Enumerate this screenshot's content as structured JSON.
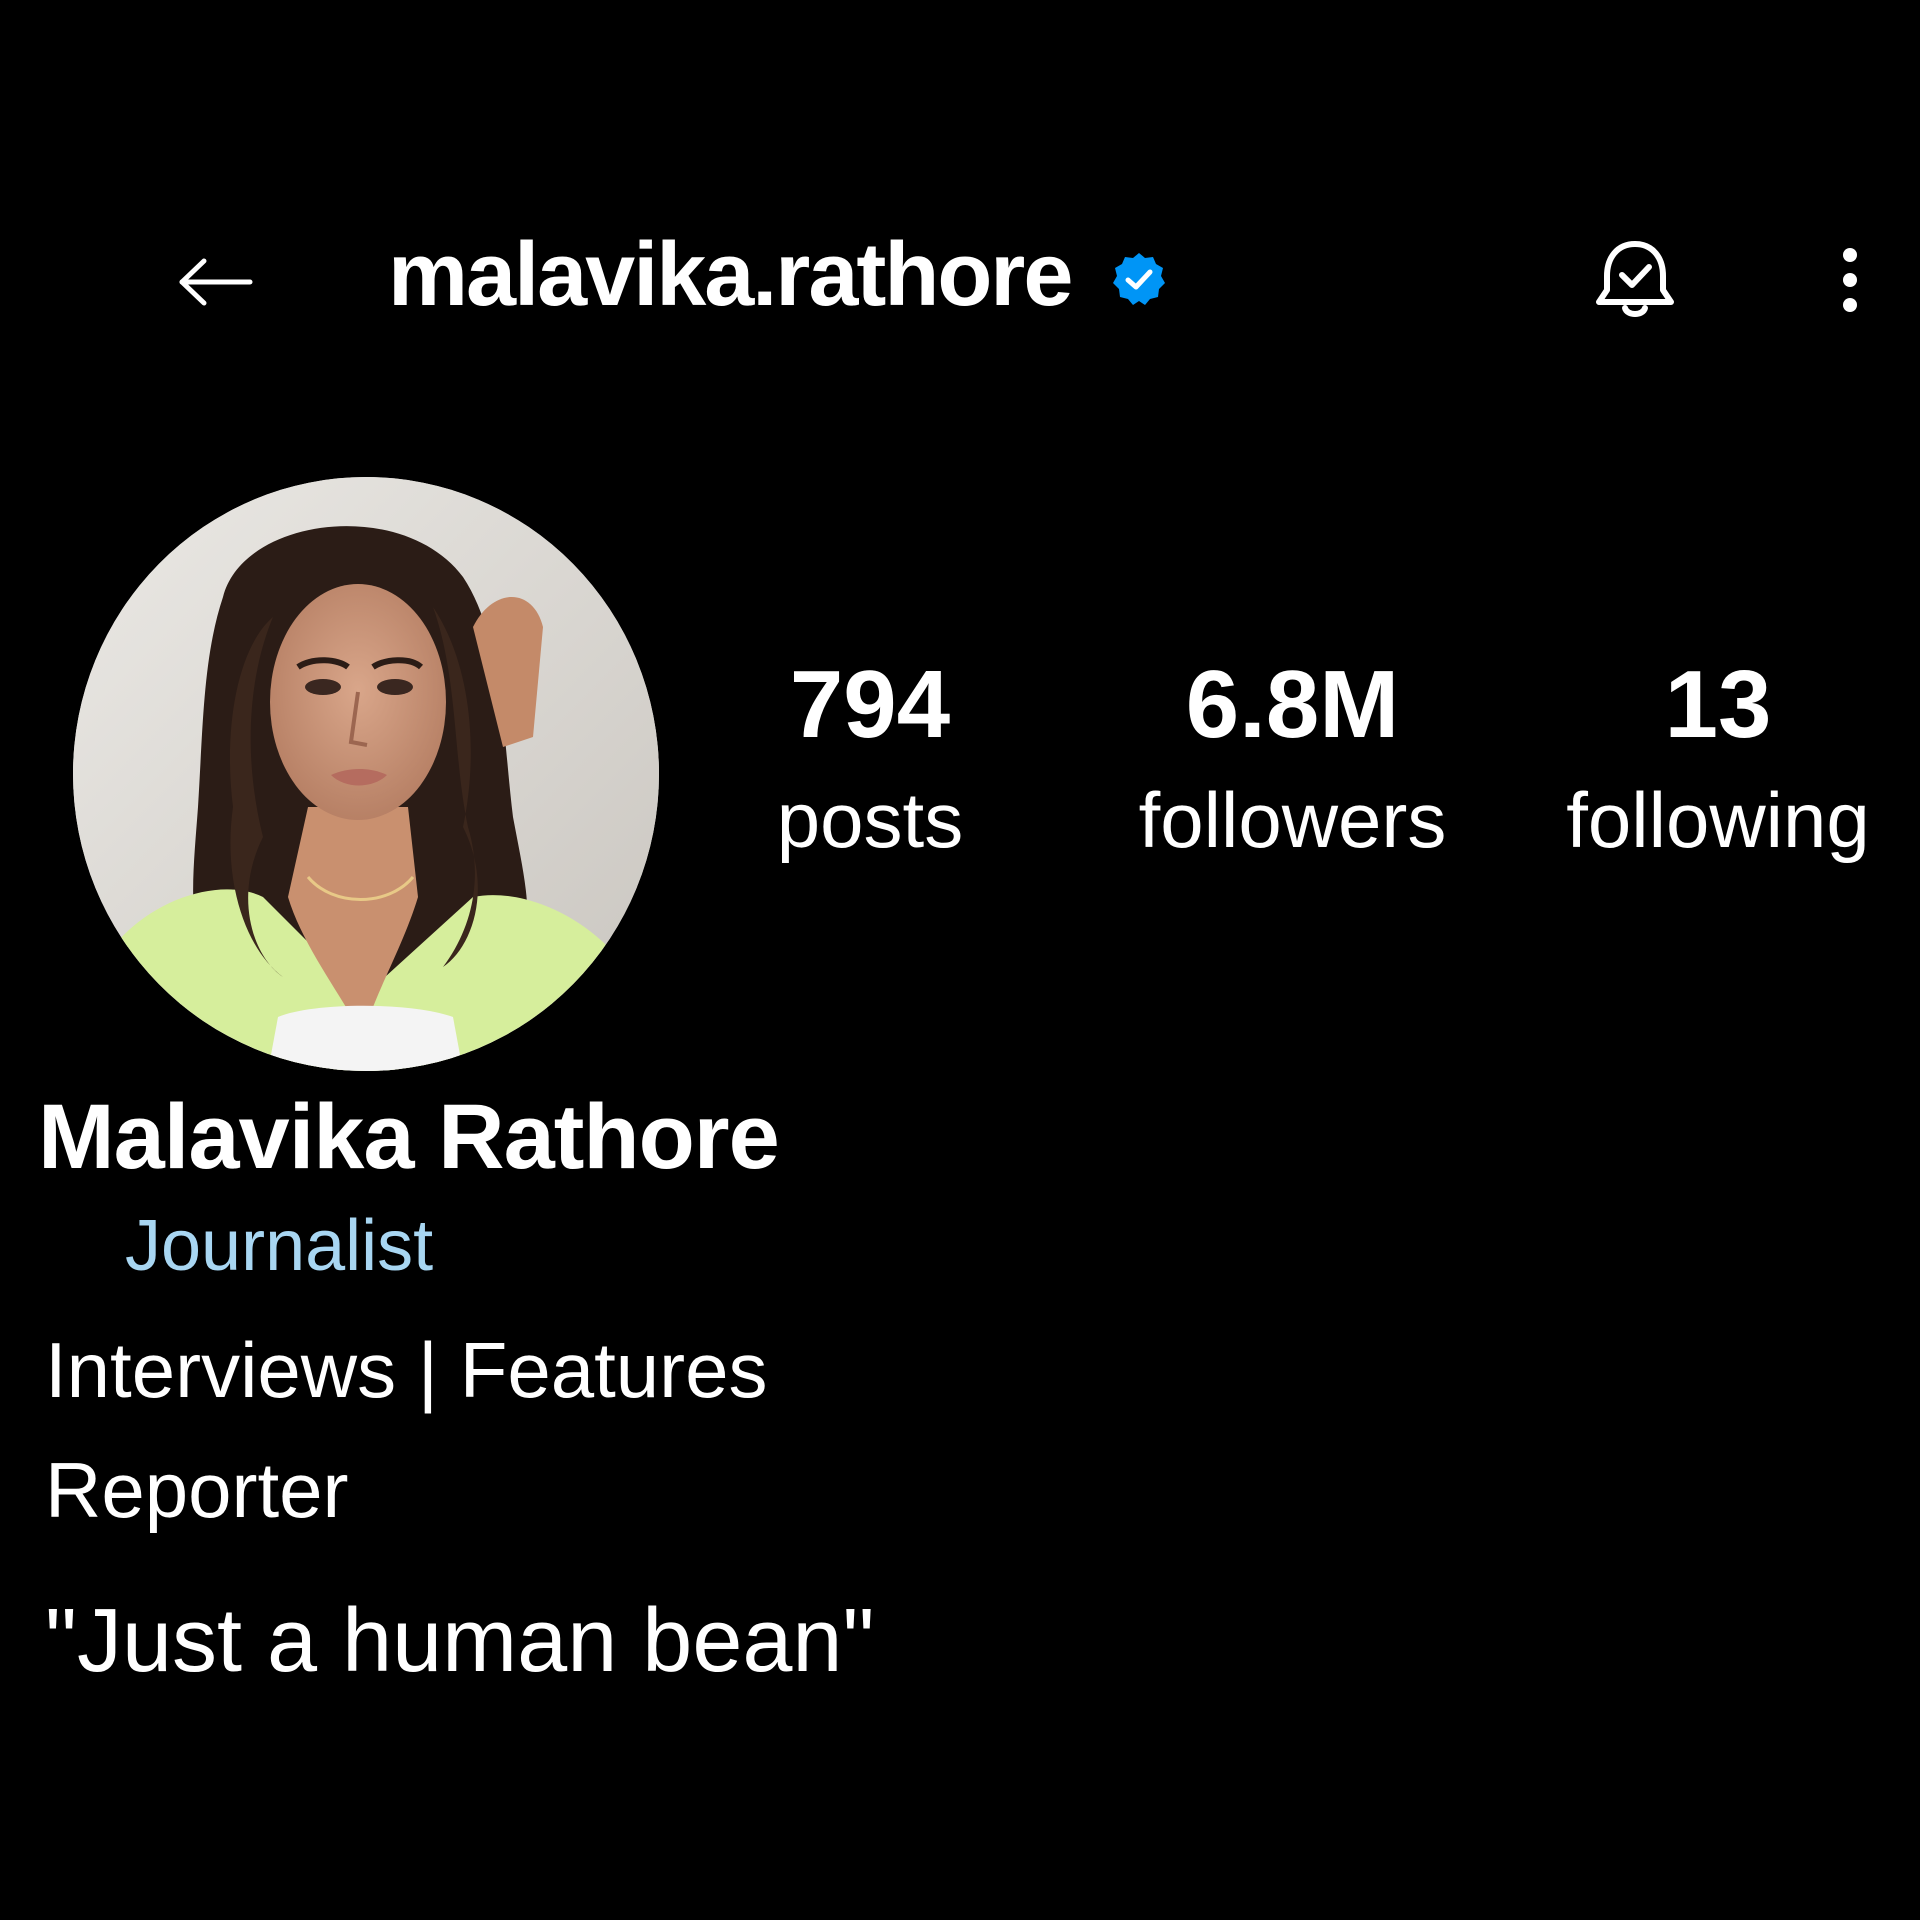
{
  "header": {
    "username": "malavika.rathore",
    "back_icon": "arrow-left-icon",
    "verified_icon": "verified-badge-icon",
    "notification_icon": "bell-check-icon",
    "more_icon": "more-vertical-icon"
  },
  "profile": {
    "avatar_icon": "profile-photo",
    "stats": [
      {
        "value": "794",
        "label": "posts"
      },
      {
        "value": "6.8M",
        "label": "followers"
      },
      {
        "value": "13",
        "label": "following"
      }
    ],
    "display_name": "Malavika Rathore",
    "category": "Journalist",
    "bio": [
      "Interviews | Features",
      "Reporter",
      "\"Just a human bean\""
    ]
  },
  "colors": {
    "background": "#000000",
    "text": "#ffffff",
    "category": "#a8d6f2",
    "verified": "#0095f6"
  }
}
